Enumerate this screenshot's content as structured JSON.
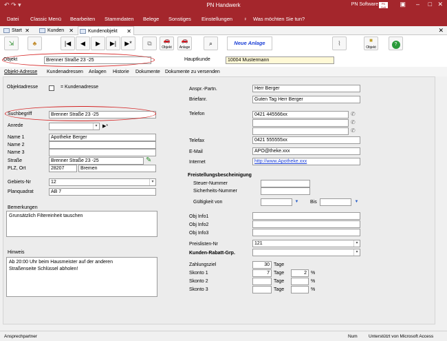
{
  "window": {
    "title": "PN Handwerk",
    "user": "PN Software",
    "badge": "PN Soft"
  },
  "menu": [
    "Datei",
    "Classic Menü",
    "Bearbeiten",
    "Stammdaten",
    "Belege",
    "Sonstiges",
    "Einstellungen",
    "Was möchten Sie tun?"
  ],
  "tabs": [
    "Start",
    "Kunden",
    "Kundenobjekt"
  ],
  "toolbar": {
    "objekt_small": "Objekt",
    "anlage_small": "Anlage",
    "neue_anlage": "Neue Anlage",
    "objekt_right": "Objekt"
  },
  "header": {
    "objekt_label": "Objekt",
    "objekt_value": "Brenner Straße 23 -25",
    "hauptkunde_label": "Hauptkunde",
    "hauptkunde_value": "10004 Mustermann"
  },
  "subtabs": [
    "Objekt-Adresse",
    "Kundenadressen",
    "Anlagen",
    "Historie",
    "Dokumente",
    "Dokumente zu versenden"
  ],
  "left": {
    "objektadresse_label": "Objektadresse",
    "kundenadresse_label": "= Kundenadresse",
    "suchbegriff_label": "Suchbegriff",
    "suchbegriff": "Brenner Straße 23 -25",
    "anrede_label": "Anrede",
    "anrede": "",
    "name1_label": "Name 1",
    "name1": "Apotheke Berger",
    "name2_label": "Name 2",
    "name2": "",
    "name3_label": "Name 3",
    "name3": "",
    "strasse_label": "Straße",
    "strasse": "Brenner Straße 23 -25",
    "plz_label": "PLZ, Ort",
    "plz": "28207",
    "ort": "Bremen",
    "gebiet_label": "Gebiets-Nr",
    "gebiet": "12",
    "planquadrat_label": "Planquadrat",
    "planquadrat": "AB 7",
    "bemerkungen_label": "Bemerkungen",
    "bemerkungen": "Grunsätzlich Filtereinheit tauschen",
    "hinweis_label": "Hinweis",
    "hinweis1": "Ab 20:00 Uhr beim Hausmeister auf der anderen",
    "hinweis2": "Straßenseite Schlüssel abholen!"
  },
  "right": {
    "ansprech_label": "Anspr.-Partn.",
    "ansprech": "Herr Berger",
    "briefanr_label": "Briefanr.",
    "briefanr": "Guten Tag Herr Berger",
    "telefon_label": "Telefon",
    "telefon1": "0421 445566xx",
    "telefon2": "",
    "telefon3": "",
    "telefax_label": "Telefax",
    "telefax": "0421 555555xx",
    "email_label": "E-Mail",
    "email": "APO@theke.xxx",
    "internet_label": "Internet",
    "internet": "http://www.Apotheke.xxx",
    "freistellung_label": "Freistellungsbescheinigung",
    "steuer_label": "Steuer-Nummer",
    "sicherheit_label": "Sicherheits-Nummer",
    "gueltig_label": "Gültigkeit von",
    "bis_label": "Bis",
    "info1_label": "Obj Info1",
    "info2_label": "Obj Info2",
    "info3_label": "Obj Info3",
    "preisliste_label": "Preislisten-Nr",
    "preisliste": "121",
    "rabatt_label": "Kunden-Rabatt-Grp.",
    "zahlungsziel_label": "Zahlungsziel",
    "zahlungsziel": "30",
    "tage": "Tage",
    "skonto1_label": "Skonto 1",
    "skonto1_tage": "7",
    "skonto1_pct": "2",
    "pct": "%",
    "skonto2_label": "Skonto 2",
    "skonto3_label": "Skonto 3"
  },
  "status": {
    "left": "Ansprechpartner",
    "num": "Num",
    "right": "Unterstützt von Microsoft Access"
  },
  "colors": {
    "accent": "#a4262c",
    "link": "#1b3fd6",
    "annotation": "#d42222"
  }
}
